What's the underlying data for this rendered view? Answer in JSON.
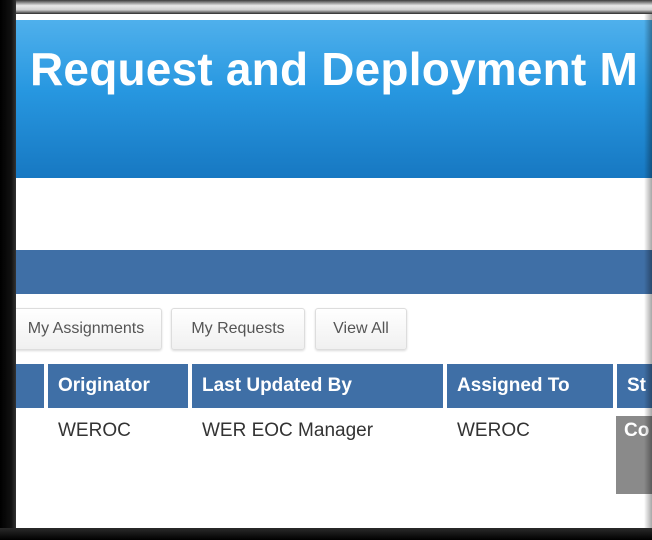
{
  "banner": {
    "title": "Request and Deployment M"
  },
  "tabs": [
    {
      "label": "My Assignments"
    },
    {
      "label": "My Requests"
    },
    {
      "label": "View All"
    }
  ],
  "table": {
    "headers": [
      "Originator",
      "Last Updated By",
      "Assigned To",
      "St"
    ],
    "rows": [
      {
        "originator": "WEROC",
        "last_updated_by": "WER EOC Manager",
        "assigned_to": "WEROC",
        "status": "Co"
      }
    ]
  },
  "colors": {
    "banner": "#2797e0",
    "header": "#3f6fa6",
    "status": "#8a8a8a"
  }
}
